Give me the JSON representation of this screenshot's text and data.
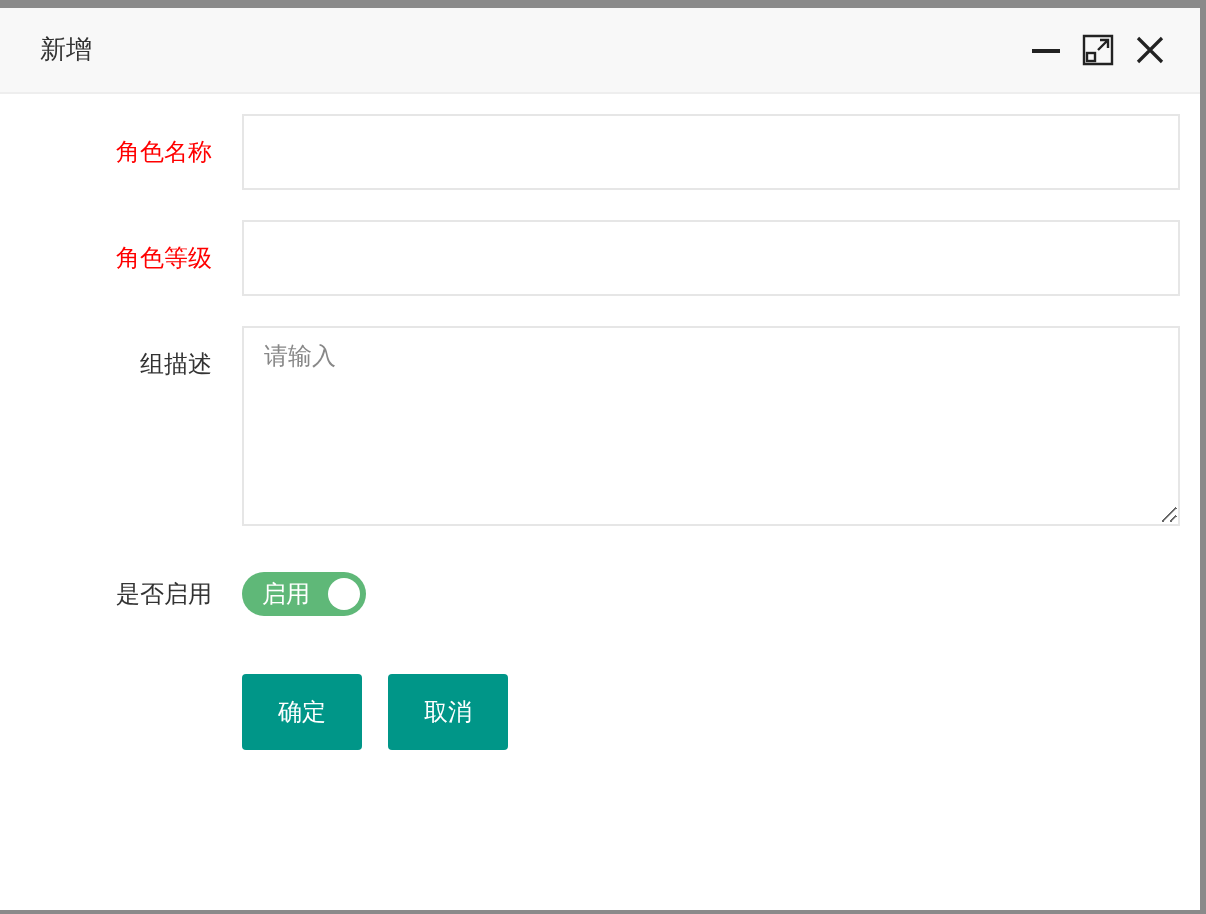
{
  "dialog": {
    "title": "新增"
  },
  "fields": [
    {
      "kind": "input",
      "label": "角色名称",
      "required": true
    },
    {
      "kind": "input",
      "label": "角色等级",
      "required": true
    },
    {
      "kind": "textarea",
      "label": "组描述",
      "required": false,
      "placeholder": "请输入"
    }
  ],
  "switch": {
    "label": "是否启用",
    "on": true,
    "text": "启用"
  },
  "buttons": [
    "确定",
    "取消"
  ]
}
